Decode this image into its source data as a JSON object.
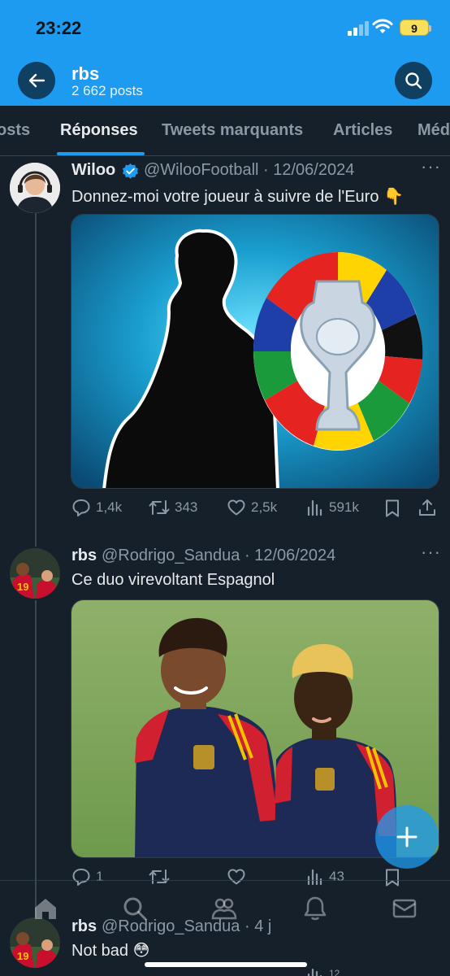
{
  "status": {
    "time": "23:22",
    "battery": "9"
  },
  "header": {
    "title": "rbs",
    "subtitle": "2 662 posts"
  },
  "tabs": [
    {
      "label": "osts"
    },
    {
      "label": "Réponses"
    },
    {
      "label": "Tweets marquants"
    },
    {
      "label": "Articles"
    },
    {
      "label": "Méd"
    }
  ],
  "tweets": [
    {
      "name": "Wiloo",
      "handle": "@WilooFootball · 12/06/2024",
      "text": "Donnez-moi votre joueur à suivre de l'Euro 👇",
      "stats": {
        "replies": "1,4k",
        "retweets": "343",
        "likes": "2,5k",
        "views": "591k"
      }
    },
    {
      "name": "rbs",
      "handle": "@Rodrigo_Sandua · 12/06/2024",
      "text": "Ce duo virevoltant Espagnol",
      "stats": {
        "replies": "1",
        "retweets": "",
        "likes": "",
        "views": "43"
      }
    },
    {
      "name": "rbs",
      "handle": "@Rodrigo_Sandua · 4 j",
      "text": "Not bad 😳",
      "stats": {
        "views": "12"
      }
    }
  ],
  "colors": {
    "accent": "#1d9bf0",
    "background": "#15202b",
    "muted": "#8b98a5"
  }
}
